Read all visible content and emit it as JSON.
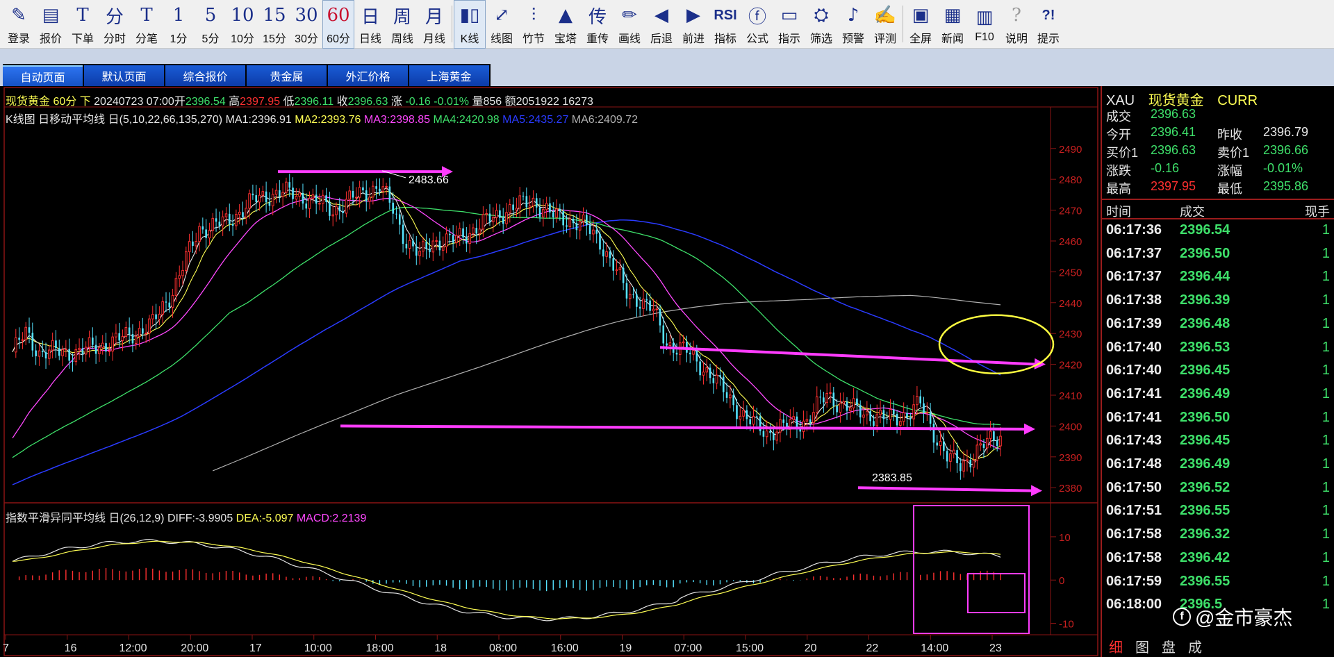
{
  "toolbar": {
    "buttons": [
      {
        "label": "登录",
        "glyph": "✎",
        "icon": "pencil-icon"
      },
      {
        "label": "报价",
        "glyph": "▤",
        "icon": "quote-list-icon"
      },
      {
        "label": "下单",
        "glyph": "T",
        "icon": "order-icon"
      },
      {
        "label": "分时",
        "glyph": "分",
        "icon": "timeshare-icon"
      },
      {
        "label": "分笔",
        "glyph": "T",
        "icon": "tick-icon"
      },
      {
        "label": "1分",
        "glyph": "1",
        "icon": "period-1m-icon"
      },
      {
        "label": "5分",
        "glyph": "5",
        "icon": "period-5m-icon"
      },
      {
        "label": "10分",
        "glyph": "10",
        "icon": "period-10m-icon"
      },
      {
        "label": "15分",
        "glyph": "15",
        "icon": "period-15m-icon"
      },
      {
        "label": "30分",
        "glyph": "30",
        "icon": "period-30m-icon"
      },
      {
        "label": "60分",
        "glyph": "60",
        "icon": "period-60m-icon"
      },
      {
        "label": "日线",
        "glyph": "日",
        "icon": "period-day-icon"
      },
      {
        "label": "周线",
        "glyph": "周",
        "icon": "period-week-icon"
      },
      {
        "label": "月线",
        "glyph": "月",
        "icon": "period-month-icon"
      },
      {
        "label": "K线",
        "glyph": "▮▯",
        "icon": "kline-icon"
      },
      {
        "label": "线图",
        "glyph": "⤢",
        "icon": "line-chart-icon"
      },
      {
        "label": "竹节",
        "glyph": "⫶",
        "icon": "bamboo-icon"
      },
      {
        "label": "宝塔",
        "glyph": "▲",
        "icon": "tower-icon"
      },
      {
        "label": "重传",
        "glyph": "传",
        "icon": "retransmit-icon"
      },
      {
        "label": "画线",
        "glyph": "✏",
        "icon": "draw-line-icon"
      },
      {
        "label": "后退",
        "glyph": "◀",
        "icon": "back-icon"
      },
      {
        "label": "前进",
        "glyph": "▶",
        "icon": "forward-icon"
      },
      {
        "label": "指标",
        "glyph": "RSI",
        "icon": "indicator-icon"
      },
      {
        "label": "公式",
        "glyph": "ⓕ",
        "icon": "formula-icon"
      },
      {
        "label": "指示",
        "glyph": "▭",
        "icon": "indicate-icon"
      },
      {
        "label": "筛选",
        "glyph": "⛭",
        "icon": "filter-icon"
      },
      {
        "label": "预警",
        "glyph": "♪",
        "icon": "alarm-icon"
      },
      {
        "label": "评测",
        "glyph": "✍",
        "icon": "evaluate-icon"
      },
      {
        "label": "全屏",
        "glyph": "▣",
        "icon": "fullscreen-icon"
      },
      {
        "label": "新闻",
        "glyph": "▦",
        "icon": "news-icon"
      },
      {
        "label": "F10",
        "glyph": "▥",
        "icon": "f10-icon"
      },
      {
        "label": "说明",
        "glyph": "?",
        "icon": "help-book-icon"
      },
      {
        "label": "提示",
        "glyph": "?!",
        "icon": "tip-icon"
      }
    ],
    "active_period": "60分",
    "active_chart": "K线"
  },
  "tabs": [
    "自动页面",
    "默认页面",
    "综合报价",
    "贵金属",
    "外汇价格",
    "上海黄金"
  ],
  "active_tab": "自动页面",
  "info": {
    "name": "现货黄金 60分 下",
    "time": "20240723 07:00",
    "open_label": "开",
    "open": "2396.54",
    "high_label": "高",
    "high": "2397.95",
    "low_label": "低",
    "low": "2396.11",
    "close_label": "收",
    "close": "2396.63",
    "change_label": "涨",
    "change": "-0.16",
    "change_pct": "-0.01%",
    "volume_label": "量",
    "volume": "856",
    "amount_label": "额",
    "amount": "2051922",
    "extra": "16273"
  },
  "ma_header": {
    "label": "K线图 日移动平均线 日(5,10,22,66,135,270)",
    "ma1": "MA1:2396.91",
    "ma2": "MA2:2393.76",
    "ma3": "MA3:2398.85",
    "ma4": "MA4:2420.98",
    "ma5": "MA5:2435.27",
    "ma6": "MA6:2409.72"
  },
  "macd_header": {
    "label": "指数平滑异同平均线 日(26,12,9)",
    "diff": "DIFF:-3.9905",
    "dea": "DEA:-5.097",
    "macd": "MACD:2.2139"
  },
  "chart_data": {
    "type": "candlestick",
    "price_axis": {
      "ticks": [
        2490,
        2480,
        2470,
        2460,
        2450,
        2440,
        2430,
        2420,
        2410,
        2400,
        2390,
        2380
      ],
      "range": [
        2376,
        2494
      ]
    },
    "macd_axis": {
      "ticks": [
        10,
        0,
        -10
      ],
      "range": [
        -12,
        14
      ]
    },
    "x_labels": [
      "7",
      "16",
      "12:00",
      "20:00",
      "17",
      "10:00",
      "18:00",
      "18",
      "08:00",
      "16:00",
      "19",
      "07:00",
      "15:00",
      "20",
      "22",
      "14:00",
      "23"
    ],
    "annotations": {
      "high": "2483.66",
      "low": "2383.85"
    },
    "colors": {
      "up": "#ff3030",
      "down": "#55e3ff",
      "ma1": "#e6e6e6",
      "ma2": "#ffff54",
      "ma3": "#ff48ff",
      "ma4": "#3ee06a",
      "ma5": "#2a3bff",
      "ma6": "#b0b0b0",
      "annotation": "#ff3cff",
      "highlight": "#ffff40"
    }
  },
  "quote": {
    "symbol": "XAU",
    "name": "现货黄金",
    "type": "CURR",
    "rows": [
      {
        "l1": "成交",
        "v1": "2396.63",
        "c1": "g"
      },
      {
        "l1": "今开",
        "v1": "2396.41",
        "c1": "g",
        "l2": "昨收",
        "v2": "2396.79",
        "c2": "w"
      },
      {
        "l1": "买价1",
        "v1": "2396.63",
        "c1": "g",
        "l2": "卖价1",
        "v2": "2396.66",
        "c2": "g"
      },
      {
        "l1": "涨跌",
        "v1": "-0.16",
        "c1": "g",
        "l2": "涨幅",
        "v2": "-0.01%",
        "c2": "g"
      },
      {
        "l1": "最高",
        "v1": "2397.95",
        "c1": "r",
        "l2": "最低",
        "v2": "2395.86",
        "c2": "g"
      }
    ]
  },
  "ticks_header": {
    "time": "时间",
    "price": "成交",
    "vol": "现手"
  },
  "ticks": [
    {
      "time": "06:17:36",
      "price": "2396.54",
      "vol": "1"
    },
    {
      "time": "06:17:37",
      "price": "2396.50",
      "vol": "1"
    },
    {
      "time": "06:17:37",
      "price": "2396.44",
      "vol": "1"
    },
    {
      "time": "06:17:38",
      "price": "2396.39",
      "vol": "1"
    },
    {
      "time": "06:17:39",
      "price": "2396.48",
      "vol": "1"
    },
    {
      "time": "06:17:40",
      "price": "2396.53",
      "vol": "1"
    },
    {
      "time": "06:17:40",
      "price": "2396.45",
      "vol": "1"
    },
    {
      "time": "06:17:41",
      "price": "2396.49",
      "vol": "1"
    },
    {
      "time": "06:17:41",
      "price": "2396.50",
      "vol": "1"
    },
    {
      "time": "06:17:43",
      "price": "2396.45",
      "vol": "1"
    },
    {
      "time": "06:17:48",
      "price": "2396.49",
      "vol": "1"
    },
    {
      "time": "06:17:50",
      "price": "2396.52",
      "vol": "1"
    },
    {
      "time": "06:17:51",
      "price": "2396.55",
      "vol": "1"
    },
    {
      "time": "06:17:58",
      "price": "2396.32",
      "vol": "1"
    },
    {
      "time": "06:17:58",
      "price": "2396.42",
      "vol": "1"
    },
    {
      "time": "06:17:59",
      "price": "2396.55",
      "vol": "1"
    },
    {
      "time": "06:18:00",
      "price": "2396.5",
      "vol": "1"
    }
  ],
  "bottom_tabs": [
    "细",
    "图",
    "盘",
    "成"
  ],
  "watermark": "@金市豪杰"
}
